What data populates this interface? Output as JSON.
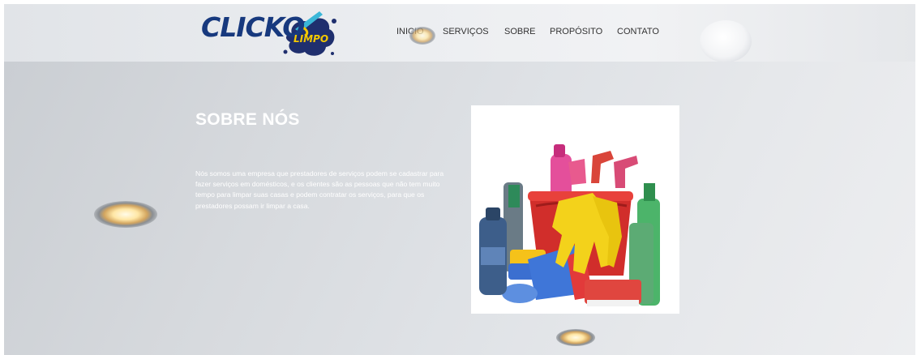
{
  "header": {
    "logo_text": "CLICKO",
    "logo_sub": "LIMPO"
  },
  "nav": {
    "items": [
      {
        "label": "INICIO"
      },
      {
        "label": "SERVIÇOS"
      },
      {
        "label": "SOBRE"
      },
      {
        "label": "PROPÓSITO"
      },
      {
        "label": "CONTATO"
      }
    ]
  },
  "about": {
    "title": "SOBRE NÓS",
    "body": "Nós somos uma empresa que prestadores de serviços podem se cadastrar para fazer serviços em domésticos, e os clientes são as pessoas que não tem muito tempo para limpar suas casas e podem contratar os serviços, para que os prestadores possam ir limpar a casa."
  },
  "colors": {
    "logo_blue": "#17397e",
    "logo_yellow": "#f4c800",
    "title_text": "#ffffff"
  }
}
